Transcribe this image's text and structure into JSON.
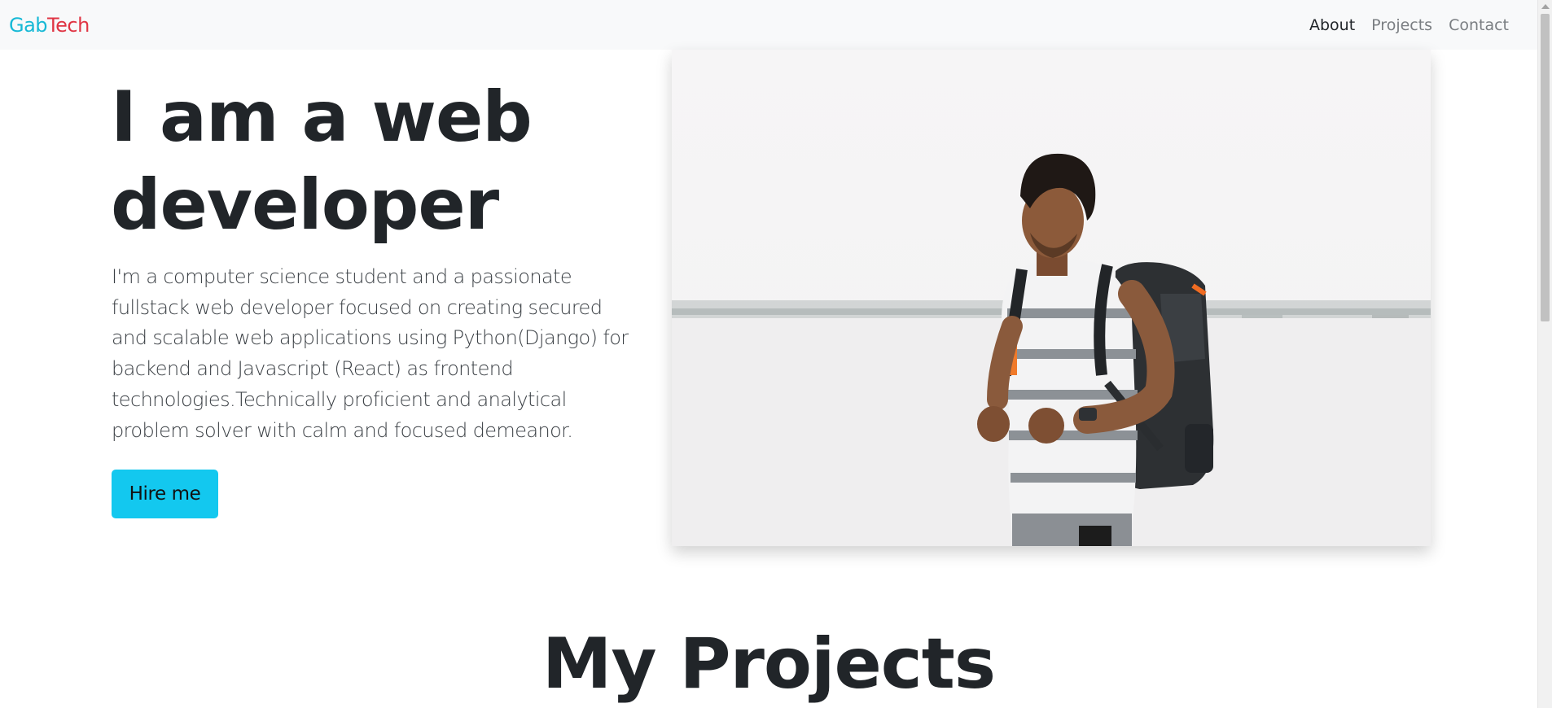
{
  "navbar": {
    "brand_part1": "Gab",
    "brand_part2": "Tech",
    "links": [
      {
        "label": "About",
        "active": true
      },
      {
        "label": "Projects",
        "active": false
      },
      {
        "label": "Contact",
        "active": false
      }
    ]
  },
  "hero": {
    "title": "I am a web developer",
    "description": "I'm a computer science student and a passionate fullstack web developer focused on creating secured and scalable web applications using Python(Django) for backend and Javascript (React) as frontend technologies.Technically proficient and analytical problem solver with calm and focused demeanor.",
    "button_label": "Hire me"
  },
  "projects": {
    "title": "My Projects"
  },
  "colors": {
    "brand_primary": "#17b9d6",
    "brand_secondary": "#e03544",
    "button": "#13c8ef",
    "navbar_bg": "#f8f9fa"
  }
}
